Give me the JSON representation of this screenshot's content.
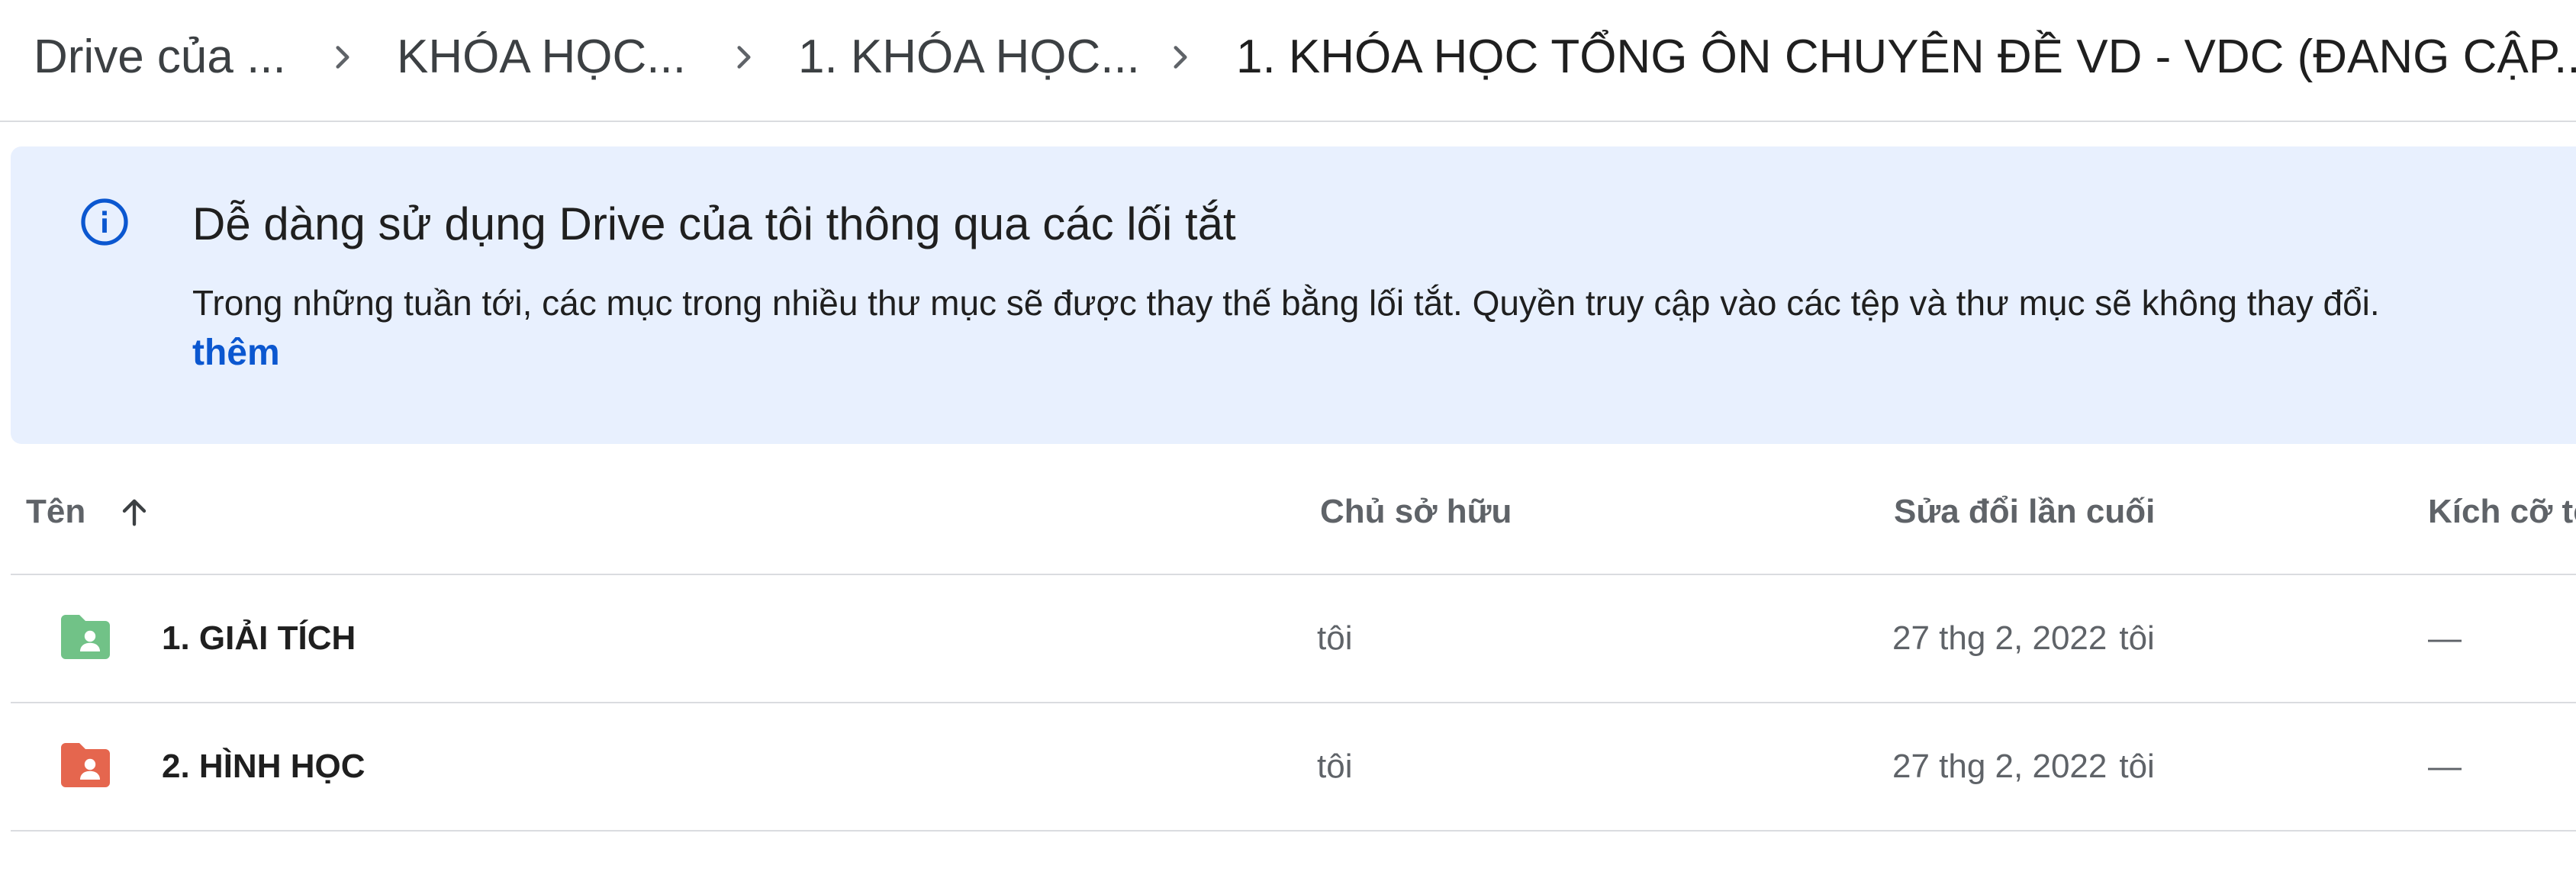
{
  "breadcrumb": {
    "items": [
      {
        "label": "Drive của ..."
      },
      {
        "label": "KHÓA HỌC..."
      },
      {
        "label": "1. KHÓA HỌC..."
      },
      {
        "label": "1. KHÓA HỌC TỔNG ÔN CHUYÊN ĐỀ VD - VDC (ĐANG CẬP..."
      }
    ],
    "separator_icon": "chevron-right-icon"
  },
  "banner": {
    "icon": "info-icon",
    "title": "Dễ dàng sử dụng Drive của tôi thông qua các lối tắt",
    "body": "Trong những tuần tới, các mục trong nhiều thư mục sẽ được thay thế bằng lối tắt. Quyền truy cập vào các tệp và thư mục sẽ không thay đổi.",
    "link": "thêm",
    "background": "#e8f0fe",
    "link_color": "#0b57d0"
  },
  "table": {
    "columns": {
      "name": "Tên",
      "owner": "Chủ sở hữu",
      "modified": "Sửa đổi lần cuối",
      "size": "Kích cỡ tệp"
    },
    "sort_icon": "arrow-upward-icon",
    "rows": [
      {
        "name": "1. GIẢI TÍCH",
        "owner": "tôi",
        "modified_date": "27 thg 2, 2022",
        "modified_by": "tôi",
        "size": "—",
        "icon": "shared-folder-icon",
        "icon_color": "#71c287"
      },
      {
        "name": "2. HÌNH HỌC",
        "owner": "tôi",
        "modified_date": "27 thg 2, 2022",
        "modified_by": "tôi",
        "size": "—",
        "icon": "shared-folder-icon",
        "icon_color": "#e5664e"
      }
    ]
  }
}
